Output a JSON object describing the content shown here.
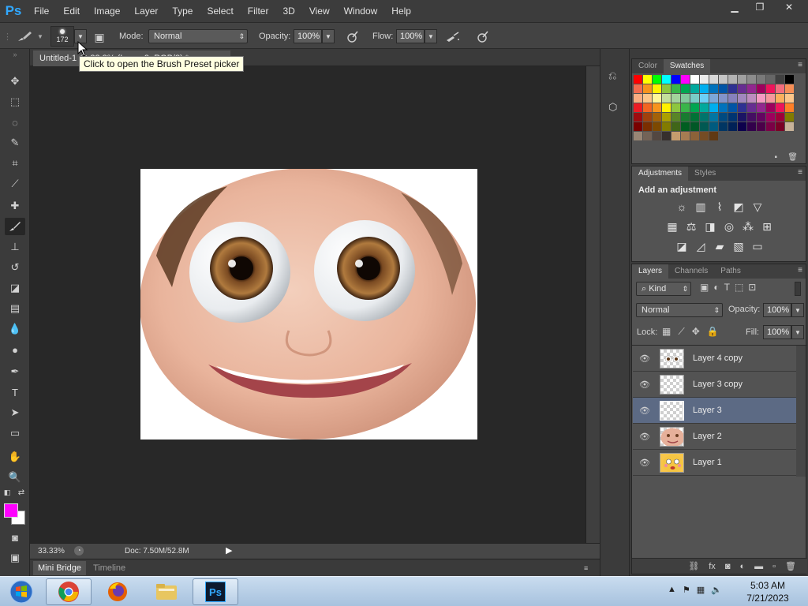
{
  "app": {
    "logo": "Ps"
  },
  "menu": [
    "File",
    "Edit",
    "Image",
    "Layer",
    "Type",
    "Select",
    "Filter",
    "3D",
    "View",
    "Window",
    "Help"
  ],
  "window_controls": {
    "minimize": "▁",
    "restore": "❐",
    "close": "✕"
  },
  "options": {
    "brush_size": "172",
    "mode_label": "Mode:",
    "mode_value": "Normal",
    "opacity_label": "Opacity:",
    "opacity_value": "100%",
    "flow_label": "Flow:",
    "flow_value": "100%"
  },
  "tooltip": "Click to open the Brush Preset picker",
  "document": {
    "tab_label": "Untitled-1 @ 33.3% (Layer 3, RGB/8) *",
    "zoom": "33.33%",
    "doc_info": "Doc: 7.50M/52.8M"
  },
  "bottom_tabs": [
    "Mini Bridge",
    "Timeline"
  ],
  "color_panel": {
    "tabs": [
      "Color",
      "Swatches"
    ],
    "active_tab": "Swatches"
  },
  "swatches": [
    "#ff0000",
    "#ffff00",
    "#00ff00",
    "#00ffff",
    "#0000ff",
    "#ff00ff",
    "#ffffff",
    "#ececec",
    "#d9d9d9",
    "#c6c6c6",
    "#b3b3b3",
    "#a0a0a0",
    "#8c8c8c",
    "#797979",
    "#666666",
    "#404040",
    "#000000",
    "#f26c4f",
    "#f7941d",
    "#fff200",
    "#8dc63f",
    "#39b54a",
    "#00a651",
    "#00a99d",
    "#00aeef",
    "#0072bc",
    "#0054a6",
    "#2e3192",
    "#662d91",
    "#92278f",
    "#9e005d",
    "#ed145b",
    "#f26d7d",
    "#f68e56",
    "#f9ad81",
    "#fdc689",
    "#fff799",
    "#c4df9b",
    "#a3d39c",
    "#82ca9d",
    "#7accc8",
    "#6dcff6",
    "#7da7d9",
    "#8393ca",
    "#8781bd",
    "#a187be",
    "#bd8cbf",
    "#f49ac2",
    "#f5989d",
    "#fbaf5d",
    "#fdc68a",
    "#ed1c24",
    "#f26522",
    "#f7941d",
    "#fff200",
    "#8dc63f",
    "#39b54a",
    "#00a651",
    "#00a99d",
    "#00aeef",
    "#0072bc",
    "#0054a6",
    "#2e3192",
    "#662d91",
    "#92278f",
    "#9e005d",
    "#ed145b",
    "#ff7f27",
    "#9e0b0f",
    "#a0410d",
    "#a36209",
    "#aba000",
    "#598527",
    "#197b30",
    "#007236",
    "#00746b",
    "#0076a3",
    "#004a80",
    "#003471",
    "#1b1464",
    "#440e62",
    "#630460",
    "#9e005d",
    "#9e0039",
    "#827b00",
    "#790000",
    "#7b2e00",
    "#7d4900",
    "#827b00",
    "#406618",
    "#005e20",
    "#005826",
    "#005952",
    "#005b7f",
    "#003663",
    "#002157",
    "#0d004c",
    "#32004b",
    "#4b0049",
    "#7b0046",
    "#7a0026",
    "#c7b299",
    "#998675",
    "#736357",
    "#534741",
    "#362f2d",
    "#c69c6d",
    "#a67c52",
    "#8c6239",
    "#754c24",
    "#603913"
  ],
  "adjustments": {
    "tabs": [
      "Adjustments",
      "Styles"
    ],
    "active_tab": "Adjustments",
    "title": "Add an adjustment"
  },
  "layers_panel": {
    "tabs": [
      "Layers",
      "Channels",
      "Paths"
    ],
    "active_tab": "Layers",
    "filter_kind": "Kind",
    "blend_mode": "Normal",
    "opacity_label": "Opacity:",
    "opacity_value": "100%",
    "lock_label": "Lock:",
    "fill_label": "Fill:",
    "fill_value": "100%",
    "layers": [
      {
        "name": "Layer 4 copy",
        "selected": false,
        "thumb": "eyes"
      },
      {
        "name": "Layer 3 copy",
        "selected": false,
        "thumb": "transparent"
      },
      {
        "name": "Layer 3",
        "selected": true,
        "thumb": "transparent"
      },
      {
        "name": "Layer 2",
        "selected": false,
        "thumb": "face"
      },
      {
        "name": "Layer 1",
        "selected": false,
        "thumb": "emoji"
      }
    ]
  },
  "taskbar": {
    "apps": [
      "start-orb",
      "chrome",
      "firefox",
      "explorer",
      "photoshop"
    ],
    "time": "5:03 AM",
    "date": "7/21/2023"
  },
  "colors": {
    "foreground": "#ff00ff",
    "background": "#ffffff",
    "selection": "#5c6a84"
  }
}
